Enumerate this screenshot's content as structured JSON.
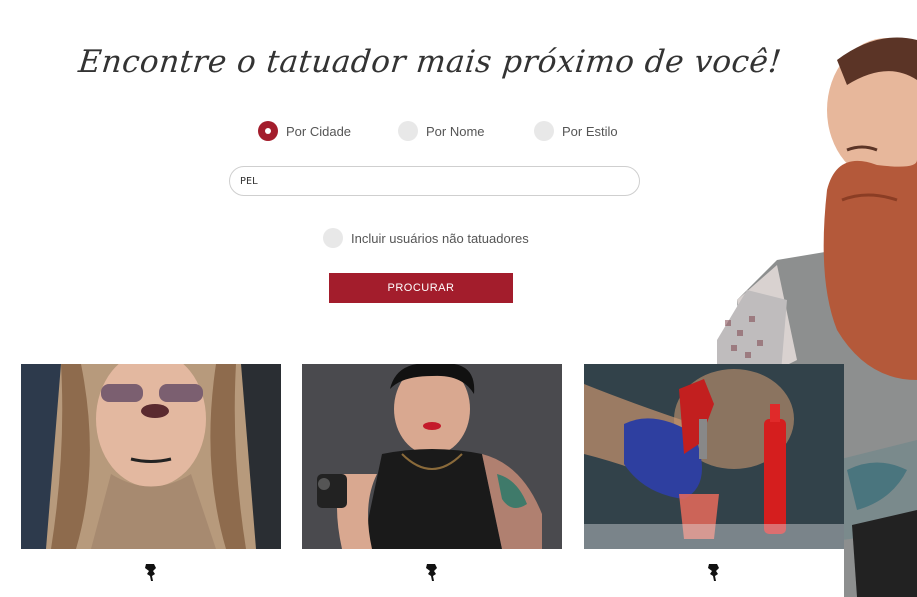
{
  "headline": "Encontre o tatuador mais próximo de você!",
  "search_mode": {
    "options": [
      {
        "label": "Por Cidade",
        "checked": true
      },
      {
        "label": "Por Nome",
        "checked": false
      },
      {
        "label": "Por Estilo",
        "checked": false
      }
    ]
  },
  "search": {
    "value": "PEL"
  },
  "include_non_tattoo": {
    "label": "Incluir usuários não tatuadores",
    "checked": false
  },
  "search_button": {
    "label": "PROCURAR"
  },
  "cards": [
    {
      "icon": "tattoo-machine-icon"
    },
    {
      "icon": "tattoo-machine-icon"
    },
    {
      "icon": "tattoo-machine-icon"
    }
  ],
  "colors": {
    "accent": "#a31d2c",
    "radio_off": "#e8e8e8",
    "input_border": "#cfcfcf"
  }
}
